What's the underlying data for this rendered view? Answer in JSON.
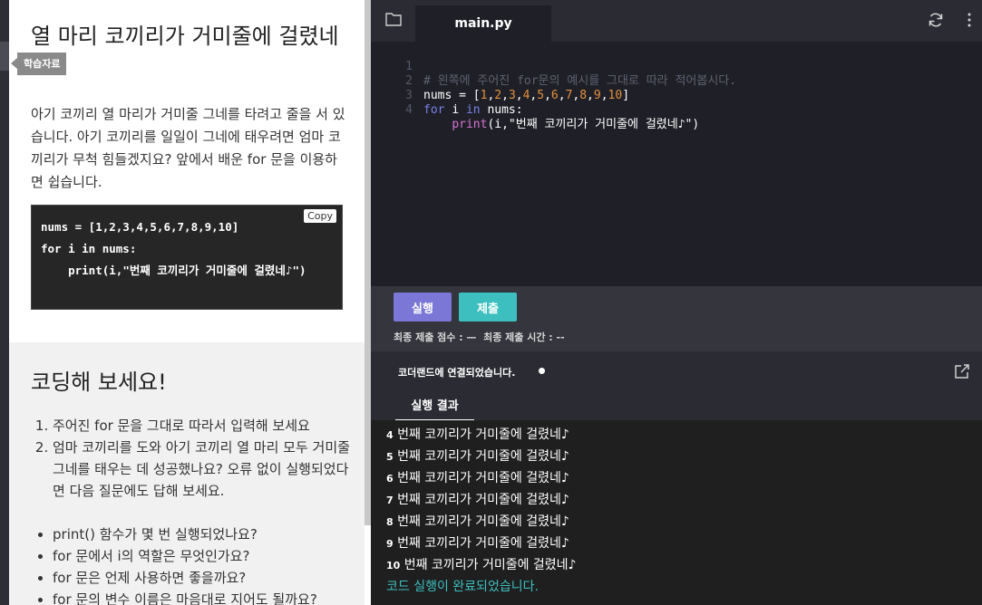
{
  "lesson": {
    "title": "열 마리 코끼리가 거미줄에 걸렸네",
    "tooltip": "학습자료",
    "intro": "아기 코끼리 열 마리가 거미줄 그네를 타려고 줄을 서 있습니다. 아기 코끼리를 일일이 그네에 태우려면 엄마 코끼리가 무척 힘들겠지요? 앞에서 배운 for 문을 이용하면 쉽습니다.",
    "code": "nums = [1,2,3,4,5,6,7,8,9,10]\nfor i in nums:\n    print(i,\"번째 코끼리가 거미줄에 걸렸네♪\")",
    "copy_label": "Copy",
    "section_title": "코딩해 보세요!",
    "steps": [
      "주어진 for 문을 그대로 따라서 입력해 보세요",
      "엄마 코끼리를 도와 아기 코끼리 열 마리 모두 거미줄 그네를 태우는 데 성공했나요? 오류 없이 실행되었다면 다음 질문에도 답해 보세요."
    ],
    "questions": [
      "print() 함수가 몇 번 실행되었나요?",
      "for 문에서 i의 역할은 무엇인가요?",
      "for 문은 언제 사용하면 좋을까요?",
      "for 문의 변수 이름은 마음대로 지어도 될까요?"
    ]
  },
  "editor": {
    "tab": "main.py",
    "line_numbers": [
      "1",
      "2",
      "3",
      "4"
    ],
    "comment": "# 왼쪽에 주어진 for문의 예시를 그대로 따라 적어봅시다.",
    "nums_name": "nums",
    "nums_values": [
      "1",
      "2",
      "3",
      "4",
      "5",
      "6",
      "7",
      "8",
      "9",
      "10"
    ],
    "for_kw": "for",
    "in_kw": "in",
    "loop_var": "i",
    "print_fn": "print",
    "print_args": "(i,\"번째 코끼리가 거미줄에 걸렸네♪\")"
  },
  "actions": {
    "run_label": "실행",
    "submit_label": "제출",
    "score": "최종 제출 점수 : —  최종 제출 시간 : --"
  },
  "console": {
    "connection": "코더랜드에 연결되었습니다.",
    "result_tab": "실행 결과",
    "output_text": "번째 코끼리가 거미줄에 걸렸네♪",
    "output_numbers": [
      "4",
      "5",
      "6",
      "7",
      "8",
      "9",
      "10"
    ],
    "done": "코드 실행이 완료되었습니다."
  },
  "colors": {
    "run_button": "#7b77d6",
    "submit_button": "#3dbfbf",
    "keyword": "#7a7fe8",
    "number": "#e38f3d",
    "function": "#d673d6"
  },
  "icons": [
    "folder-icon",
    "refresh-icon",
    "more-vertical-icon",
    "external-link-icon"
  ]
}
